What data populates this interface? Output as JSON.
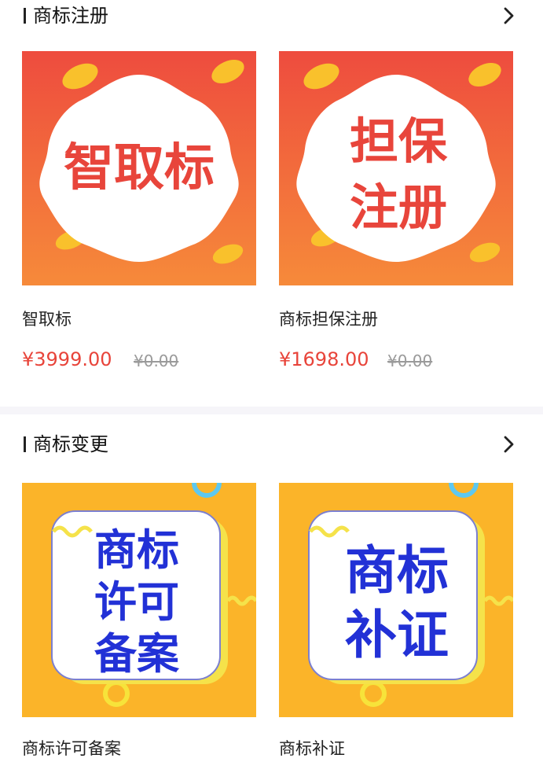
{
  "sections": [
    {
      "title": "商标注册",
      "products": [
        {
          "name": "智取标",
          "price": "¥3999.00",
          "original_price": "¥0.00",
          "image_text": [
            "智取标"
          ]
        },
        {
          "name": "商标担保注册",
          "price": "¥1698.00",
          "original_price": "¥0.00",
          "image_text": [
            "担保",
            "注册"
          ]
        }
      ]
    },
    {
      "title": "商标变更",
      "products": [
        {
          "name": "商标许可备案",
          "image_text": [
            "商标",
            "许可",
            "备案"
          ]
        },
        {
          "name": "商标补证",
          "image_text": [
            "商标",
            "补证"
          ]
        }
      ]
    }
  ],
  "colors": {
    "price_red": "#e8443a",
    "banner_orange": "#f0573d",
    "banner_yellow": "#fbb429",
    "image_text_red": "#e8453b",
    "image_text_blue": "#2231d6"
  },
  "icons": [
    "chevron-right-icon",
    "coin-icon",
    "squiggle-icon"
  ]
}
